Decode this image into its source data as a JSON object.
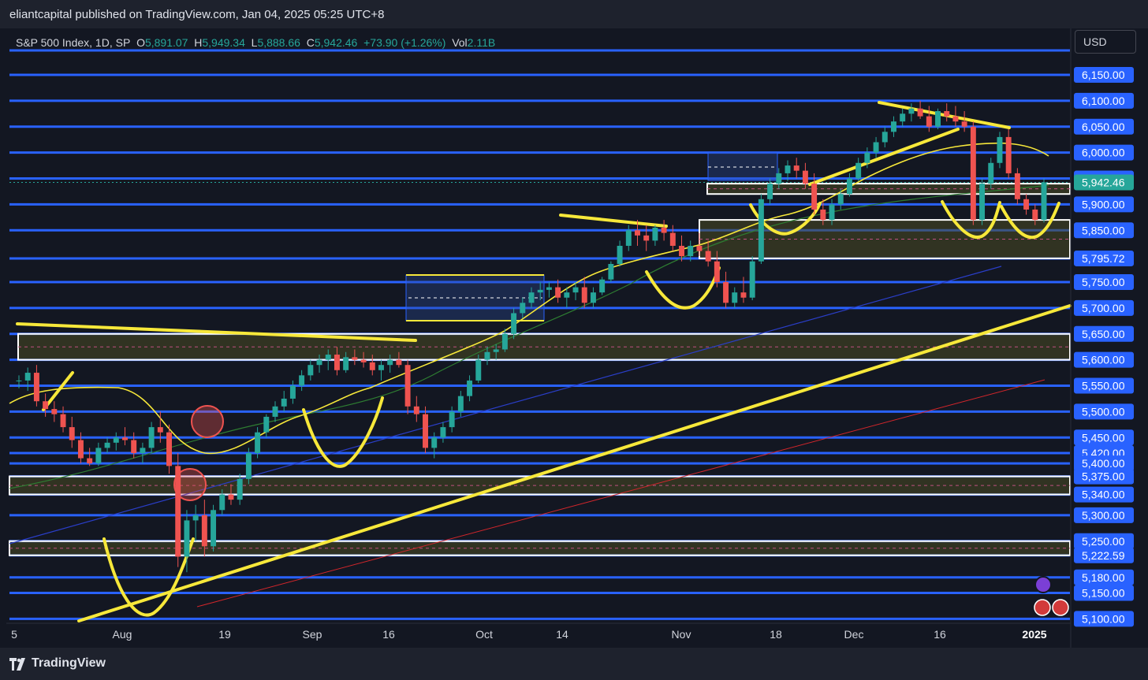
{
  "header": {
    "publisher": "eliantcapital published on TradingView.com, Jan 04, 2025 05:25 UTC+8"
  },
  "legend": {
    "symbol": "S&P 500 Index, 1D, SP",
    "open_label": "O",
    "open": "5,891.07",
    "high_label": "H",
    "high": "5,949.34",
    "low_label": "L",
    "low": "5,888.66",
    "close_label": "C",
    "close": "5,942.46",
    "change": "+73.90 (+1.26%)",
    "vol_label": "Vol",
    "vol": "2.11B"
  },
  "currency": "USD",
  "footer": {
    "brand": "TradingView"
  },
  "colors": {
    "bg": "#131722",
    "level_blue": "#2962ff",
    "zone_white": "#ffffff",
    "zone_fill": "#4a4a22",
    "annotation": "#f7e83a",
    "up": "#26a69a",
    "down": "#ef5350",
    "current_price_bg": "#26a69a"
  },
  "chart_data": {
    "type": "candlestick",
    "symbol": "S&P 500 Index",
    "interval": "1D",
    "x_ticks": [
      "5",
      "Aug",
      "19",
      "Sep",
      "16",
      "Oct",
      "14",
      "Nov",
      "18",
      "Dec",
      "16",
      "2025"
    ],
    "price_labels": [
      "6,150.00",
      "6,100.00",
      "6,050.00",
      "6,000.00",
      "5,950.00",
      "5,900.00",
      "5,850.00",
      "5,795.72",
      "5,750.00",
      "5,700.00",
      "5,650.00",
      "5,600.00",
      "5,550.00",
      "5,500.00",
      "5,450.00",
      "5,420.00",
      "5,400.00",
      "5,375.00",
      "5,340.00",
      "5,300.00",
      "5,250.00",
      "5,222.59",
      "5,180.00",
      "5,150.00",
      "5,100.00"
    ],
    "current_price": "5,942.46",
    "current_price_value": 5942.46,
    "horizontal_levels": [
      6150,
      6100,
      6050,
      6000,
      5950,
      5900,
      5850,
      5795.72,
      5750,
      5700,
      5650,
      5600,
      5550,
      5500,
      5450,
      5420,
      5400,
      5375,
      5340,
      5300,
      5250,
      5222.59,
      5180,
      5150,
      5100
    ],
    "zones": [
      {
        "from": 5600,
        "to": 5650
      },
      {
        "from": 5340,
        "to": 5375
      },
      {
        "from": 5222.59,
        "to": 5250
      },
      {
        "from": 5795.72,
        "to": 5870
      },
      {
        "from": 5920,
        "to": 5940
      }
    ],
    "candles": [
      [
        5560,
        5570,
        5545,
        5560
      ],
      [
        5560,
        5585,
        5540,
        5575
      ],
      [
        5575,
        5590,
        5510,
        5520
      ],
      [
        5520,
        5535,
        5490,
        5505
      ],
      [
        5505,
        5520,
        5480,
        5495
      ],
      [
        5495,
        5510,
        5460,
        5470
      ],
      [
        5470,
        5490,
        5430,
        5445
      ],
      [
        5445,
        5460,
        5400,
        5410
      ],
      [
        5410,
        5430,
        5395,
        5400
      ],
      [
        5400,
        5440,
        5395,
        5430
      ],
      [
        5430,
        5450,
        5420,
        5440
      ],
      [
        5440,
        5460,
        5425,
        5450
      ],
      [
        5450,
        5470,
        5435,
        5445
      ],
      [
        5445,
        5460,
        5410,
        5420
      ],
      [
        5420,
        5440,
        5400,
        5430
      ],
      [
        5430,
        5480,
        5420,
        5470
      ],
      [
        5470,
        5500,
        5440,
        5460
      ],
      [
        5460,
        5475,
        5380,
        5395
      ],
      [
        5395,
        5420,
        5200,
        5220
      ],
      [
        5220,
        5310,
        5190,
        5290
      ],
      [
        5290,
        5320,
        5250,
        5300
      ],
      [
        5300,
        5330,
        5220,
        5240
      ],
      [
        5240,
        5320,
        5230,
        5310
      ],
      [
        5310,
        5350,
        5300,
        5340
      ],
      [
        5340,
        5360,
        5320,
        5330
      ],
      [
        5330,
        5380,
        5320,
        5370
      ],
      [
        5370,
        5430,
        5360,
        5420
      ],
      [
        5420,
        5470,
        5410,
        5460
      ],
      [
        5460,
        5495,
        5450,
        5490
      ],
      [
        5490,
        5520,
        5480,
        5510
      ],
      [
        5510,
        5540,
        5500,
        5525
      ],
      [
        5525,
        5560,
        5515,
        5550
      ],
      [
        5550,
        5580,
        5540,
        5570
      ],
      [
        5570,
        5600,
        5560,
        5590
      ],
      [
        5590,
        5610,
        5575,
        5600
      ],
      [
        5600,
        5620,
        5580,
        5610
      ],
      [
        5610,
        5625,
        5570,
        5580
      ],
      [
        5580,
        5615,
        5575,
        5605
      ],
      [
        5605,
        5620,
        5590,
        5600
      ],
      [
        5600,
        5615,
        5585,
        5595
      ],
      [
        5595,
        5610,
        5570,
        5580
      ],
      [
        5580,
        5600,
        5560,
        5590
      ],
      [
        5590,
        5610,
        5575,
        5600
      ],
      [
        5600,
        5615,
        5585,
        5590
      ],
      [
        5590,
        5600,
        5495,
        5510
      ],
      [
        5510,
        5530,
        5480,
        5495
      ],
      [
        5495,
        5510,
        5420,
        5430
      ],
      [
        5430,
        5460,
        5410,
        5450
      ],
      [
        5450,
        5480,
        5440,
        5470
      ],
      [
        5470,
        5510,
        5460,
        5500
      ],
      [
        5500,
        5540,
        5490,
        5530
      ],
      [
        5530,
        5570,
        5520,
        5560
      ],
      [
        5560,
        5610,
        5555,
        5600
      ],
      [
        5600,
        5625,
        5590,
        5615
      ],
      [
        5615,
        5630,
        5600,
        5620
      ],
      [
        5620,
        5660,
        5615,
        5650
      ],
      [
        5650,
        5700,
        5640,
        5690
      ],
      [
        5690,
        5720,
        5680,
        5710
      ],
      [
        5710,
        5740,
        5700,
        5730
      ],
      [
        5730,
        5750,
        5715,
        5735
      ],
      [
        5735,
        5750,
        5720,
        5740
      ],
      [
        5740,
        5755,
        5710,
        5720
      ],
      [
        5720,
        5740,
        5700,
        5730
      ],
      [
        5730,
        5750,
        5715,
        5740
      ],
      [
        5740,
        5760,
        5700,
        5710
      ],
      [
        5710,
        5740,
        5700,
        5730
      ],
      [
        5730,
        5760,
        5725,
        5755
      ],
      [
        5755,
        5790,
        5750,
        5785
      ],
      [
        5785,
        5830,
        5780,
        5820
      ],
      [
        5820,
        5860,
        5810,
        5850
      ],
      [
        5850,
        5870,
        5820,
        5840
      ],
      [
        5840,
        5860,
        5810,
        5830
      ],
      [
        5830,
        5860,
        5820,
        5855
      ],
      [
        5855,
        5870,
        5830,
        5845
      ],
      [
        5845,
        5860,
        5810,
        5820
      ],
      [
        5820,
        5840,
        5790,
        5800
      ],
      [
        5800,
        5830,
        5790,
        5820
      ],
      [
        5820,
        5845,
        5800,
        5810
      ],
      [
        5810,
        5830,
        5780,
        5790
      ],
      [
        5790,
        5810,
        5740,
        5750
      ],
      [
        5750,
        5770,
        5700,
        5710
      ],
      [
        5710,
        5740,
        5700,
        5730
      ],
      [
        5730,
        5760,
        5710,
        5720
      ],
      [
        5720,
        5800,
        5715,
        5790
      ],
      [
        5790,
        5920,
        5785,
        5910
      ],
      [
        5910,
        5950,
        5900,
        5940
      ],
      [
        5940,
        5970,
        5930,
        5960
      ],
      [
        5960,
        5985,
        5945,
        5975
      ],
      [
        5975,
        5990,
        5950,
        5965
      ],
      [
        5965,
        5980,
        5930,
        5940
      ],
      [
        5940,
        5960,
        5880,
        5890
      ],
      [
        5890,
        5910,
        5860,
        5870
      ],
      [
        5870,
        5910,
        5860,
        5900
      ],
      [
        5900,
        5930,
        5890,
        5920
      ],
      [
        5920,
        5960,
        5915,
        5950
      ],
      [
        5950,
        5990,
        5945,
        5980
      ],
      [
        5980,
        6010,
        5970,
        6000
      ],
      [
        6000,
        6030,
        5990,
        6020
      ],
      [
        6020,
        6050,
        6010,
        6040
      ],
      [
        6040,
        6070,
        6030,
        6060
      ],
      [
        6060,
        6085,
        6050,
        6075
      ],
      [
        6075,
        6095,
        6060,
        6085
      ],
      [
        6085,
        6100,
        6065,
        6070
      ],
      [
        6070,
        6090,
        6040,
        6050
      ],
      [
        6050,
        6085,
        6045,
        6080
      ],
      [
        6080,
        6095,
        6060,
        6070
      ],
      [
        6070,
        6090,
        6050,
        6060
      ],
      [
        6060,
        6080,
        6040,
        6050
      ],
      [
        6050,
        6060,
        5860,
        5870
      ],
      [
        5870,
        5950,
        5860,
        5940
      ],
      [
        5940,
        5990,
        5930,
        5980
      ],
      [
        5980,
        6040,
        5970,
        6030
      ],
      [
        6030,
        6045,
        5950,
        5960
      ],
      [
        5960,
        5970,
        5900,
        5910
      ],
      [
        5910,
        5920,
        5880,
        5890
      ],
      [
        5890,
        5900,
        5860,
        5870
      ],
      [
        5870,
        5950,
        5865,
        5942.46
      ]
    ],
    "y_range": [
      5095,
      6190
    ]
  }
}
